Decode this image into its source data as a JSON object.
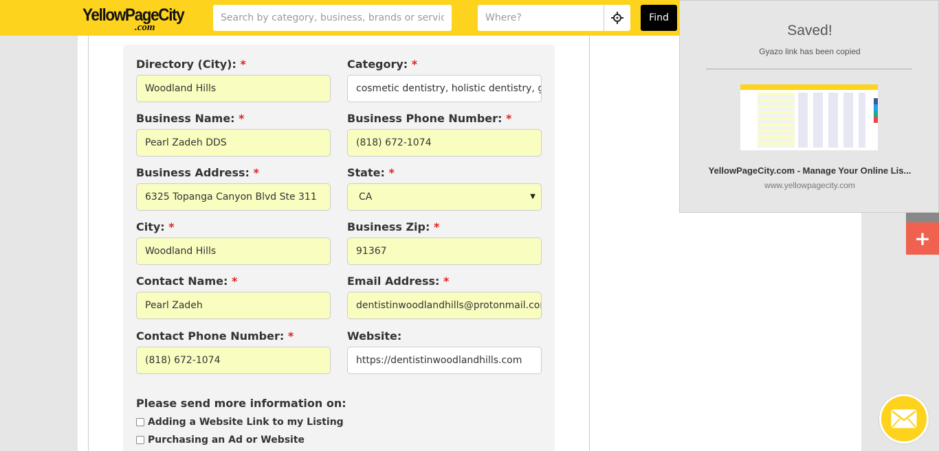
{
  "header": {
    "logo_main": "YellowPageCity",
    "logo_sub": ".com",
    "search_placeholder": "Search by category, business, brands or services",
    "where_placeholder": "Where?",
    "find_label": "Find",
    "brand_color": "#fdd31d"
  },
  "form": {
    "required_mark": "*",
    "fields": {
      "directory": {
        "label": "Directory (City):",
        "value": "Woodland Hills",
        "required": true
      },
      "category": {
        "label": "Category:",
        "value": "cosmetic dentistry, holistic dentistry, ge",
        "required": true
      },
      "business_name": {
        "label": "Business Name:",
        "value": "Pearl Zadeh DDS",
        "required": true
      },
      "business_phone": {
        "label": "Business Phone Number:",
        "value": "(818) 672-1074",
        "required": true
      },
      "business_address": {
        "label": "Business Address:",
        "value": "6325 Topanga Canyon Blvd Ste 311",
        "required": true
      },
      "state": {
        "label": "State:",
        "value": "CA",
        "required": true
      },
      "city": {
        "label": "City:",
        "value": "Woodland Hills",
        "required": true
      },
      "zip": {
        "label": "Business Zip:",
        "value": "91367",
        "required": true
      },
      "contact_name": {
        "label": "Contact Name:",
        "value": "Pearl Zadeh",
        "required": true
      },
      "email": {
        "label": "Email Address:",
        "value": "dentistinwoodlandhills@protonmail.cor",
        "required": true
      },
      "contact_phone": {
        "label": "Contact Phone Number:",
        "value": "(818) 672-1074",
        "required": true
      },
      "website": {
        "label": "Website:",
        "value": "https://dentistinwoodlandhills.com",
        "required": false
      }
    },
    "more_info": {
      "heading": "Please send more information on:",
      "options": [
        "Adding a Website Link to my Listing",
        "Purchasing an Ad or Website"
      ]
    },
    "filled_field_color": "#fafdc0",
    "required_color": "#e02020"
  },
  "gyazo": {
    "saved": "Saved!",
    "copied": "Gyazo link has been copied",
    "page_title": "YellowPageCity.com - Manage Your Online Lis...",
    "page_url": "www.yellowpagecity.com"
  },
  "floating": {
    "plus_icon": "+",
    "plus_color": "#f0624f",
    "mail_icon": "envelope-icon"
  }
}
